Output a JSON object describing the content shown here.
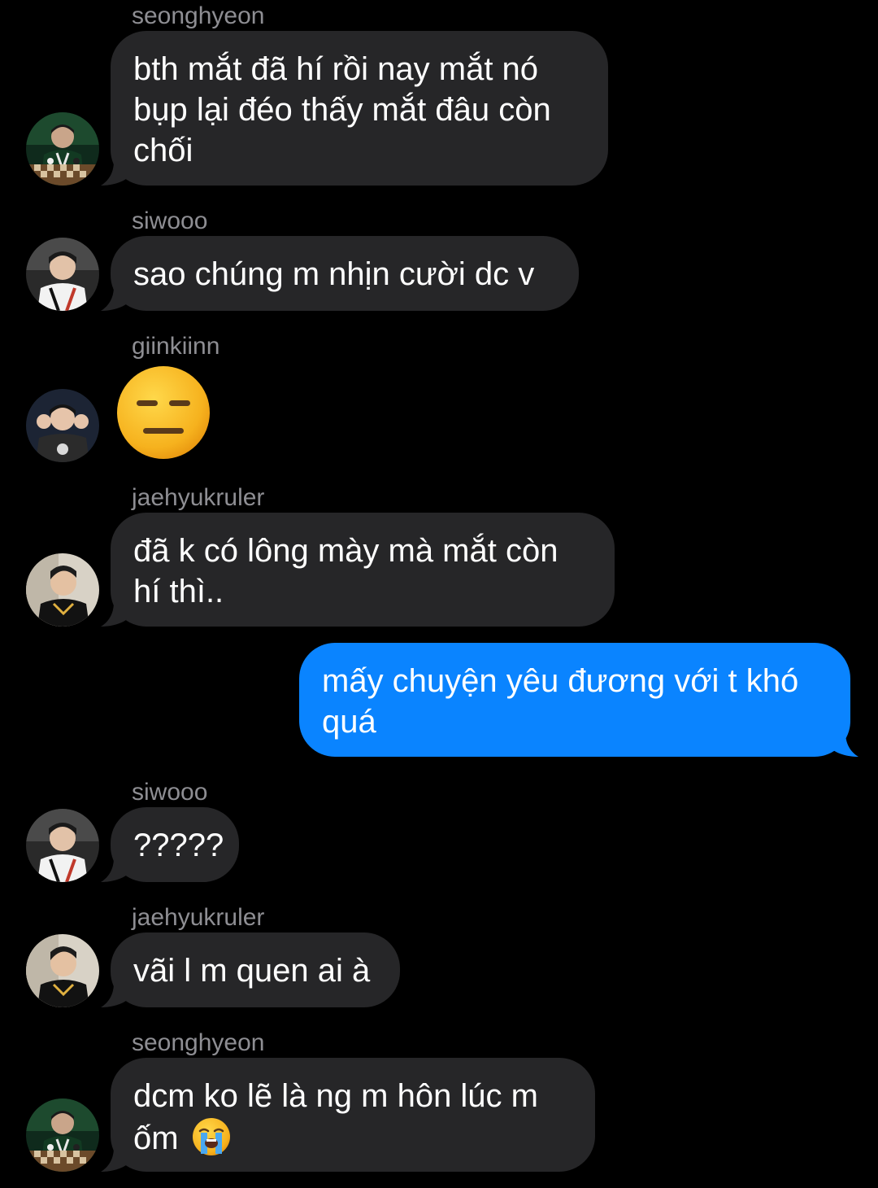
{
  "messages": [
    {
      "sender": "seonghyeon",
      "lines": [
        "bth mắt đã hí rồi nay mắt nó",
        "bụp lại đéo thấy mắt đâu còn",
        "chối"
      ],
      "avatar_icon": "seonghyeon-avatar-icon"
    },
    {
      "sender": "siwooo",
      "lines": [
        "sao chúng m nhịn cười dc v"
      ],
      "avatar_icon": "siwooo-avatar-icon"
    },
    {
      "sender": "giinkiinn",
      "emoji": "expressionless-face-emoji",
      "avatar_icon": "giinkiinn-avatar-icon"
    },
    {
      "sender": "jaehyukruler",
      "lines": [
        "đã k có lông mày mà mắt còn",
        "hí thì.."
      ],
      "avatar_icon": "jaehyukruler-avatar-icon"
    },
    {
      "outgoing": true,
      "lines": [
        "mấy chuyện yêu đương với t khó",
        "quá"
      ]
    },
    {
      "sender": "siwooo",
      "lines": [
        "?????"
      ],
      "avatar_icon": "siwooo-avatar-icon"
    },
    {
      "sender": "jaehyukruler",
      "lines": [
        "vãi l m quen ai à"
      ],
      "avatar_icon": "jaehyukruler-avatar-icon"
    },
    {
      "sender": "seonghyeon",
      "lines": [
        "dcm ko lẽ là ng m hôn lúc m",
        "ốm"
      ],
      "trailing_emoji": "loudly-crying-face-emoji",
      "avatar_icon": "seonghyeon-avatar-icon"
    }
  ],
  "colors": {
    "background": "#000000",
    "incoming_bubble": "#262628",
    "outgoing_bubble": "#0a84ff",
    "sender_name": "#8e8e93",
    "text": "#ffffff"
  }
}
